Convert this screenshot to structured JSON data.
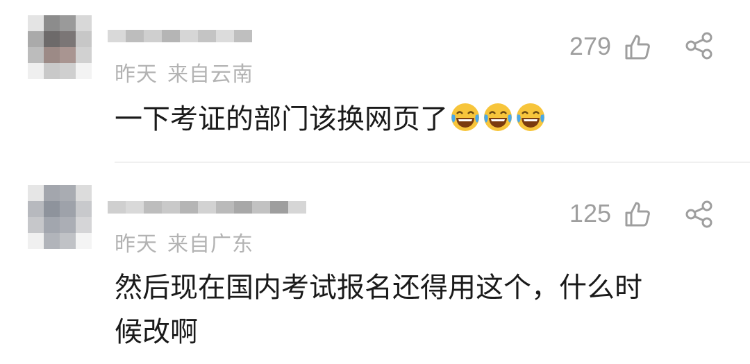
{
  "comments": [
    {
      "date": "昨天",
      "location": "来自云南",
      "likes": "279",
      "text": "一下考证的部门该换网页了",
      "emoji_count": 3,
      "emoji": "laughing-crying-emoji"
    },
    {
      "date": "昨天",
      "location": "来自广东",
      "likes": "125",
      "text_line1": "然后现在国内考试报名还得用这个，什么时",
      "text_line2": "候改啊"
    }
  ]
}
